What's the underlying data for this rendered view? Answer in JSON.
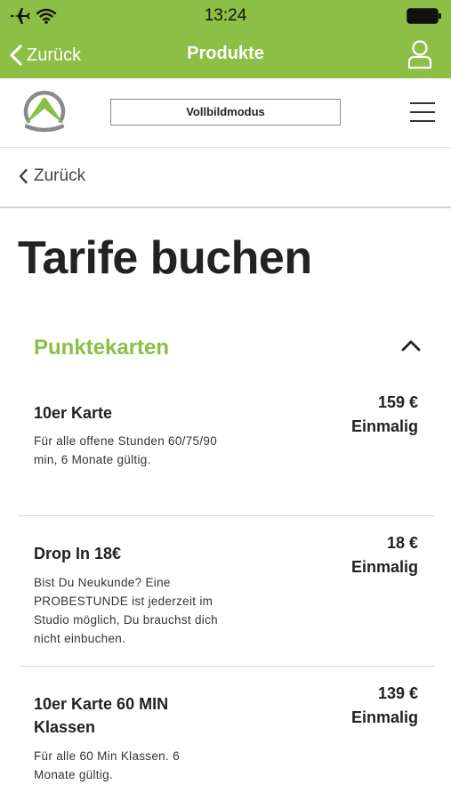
{
  "status_bar": {
    "time": "13:24"
  },
  "nav": {
    "back_label": "Zurück",
    "title": "Produkte"
  },
  "header": {
    "fullscreen_label": "Vollbildmodus"
  },
  "back_row": {
    "label": "Zurück"
  },
  "page": {
    "title": "Tarife buchen"
  },
  "section": {
    "title": "Punktekarten"
  },
  "products": [
    {
      "name": "10er Karte",
      "description": "Für alle offene Stunden 60/75/90 min, 6 Monate gültig.",
      "price": "159 €",
      "billing": "Einmalig"
    },
    {
      "name": "Drop In 18€",
      "description": "Bist Du Neukunde? Eine PROBESTUNDE ist jederzeit im Studio möglich, Du brauchst dich nicht einbuchen.",
      "price": "18 €",
      "billing": "Einmalig"
    },
    {
      "name": "10er Karte 60 MIN Klassen",
      "description": "Für alle 60 Min Klassen. 6 Monate gültig.",
      "price": "139 €",
      "billing": "Einmalig"
    }
  ],
  "colors": {
    "brand_green": "#8dbe45",
    "text_dark": "#222222",
    "divider": "#d6d6d6"
  }
}
